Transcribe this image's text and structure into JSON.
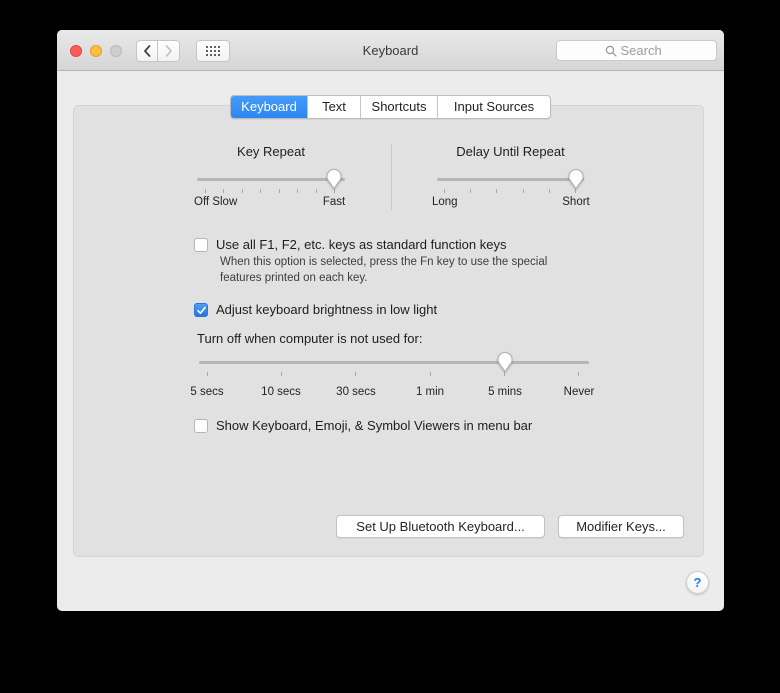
{
  "window": {
    "title": "Keyboard",
    "toolbar": {
      "search_placeholder": "Search"
    },
    "tabs": [
      {
        "label": "Keyboard",
        "selected": true
      },
      {
        "label": "Text",
        "selected": false
      },
      {
        "label": "Shortcuts",
        "selected": false
      },
      {
        "label": "Input Sources",
        "selected": false
      }
    ],
    "help_label": "?"
  },
  "panel": {
    "key_repeat": {
      "title": "Key Repeat",
      "min_label": "Off Slow",
      "max_label": "Fast",
      "ticks": 8,
      "value_index": 7,
      "value": "Fast"
    },
    "delay": {
      "title": "Delay Until Repeat",
      "min_label": "Long",
      "max_label": "Short",
      "ticks": 6,
      "value_index": 5,
      "value": "Short"
    },
    "fn_checkbox": {
      "label": "Use all F1, F2, etc. keys as standard function keys",
      "checked": false,
      "description": [
        "When this option is selected, press the Fn key to use the special",
        "features printed on each key."
      ]
    },
    "brightness_checkbox": {
      "label": "Adjust keyboard brightness in low light",
      "checked": true
    },
    "turnoff": {
      "label": "Turn off when computer is not used for:",
      "options": [
        "5 secs",
        "10 secs",
        "30 secs",
        "1 min",
        "5 mins",
        "Never"
      ],
      "value": "5 mins",
      "value_index": 4
    },
    "viewers_checkbox": {
      "label": "Show Keyboard, Emoji, & Symbol Viewers in menu bar",
      "checked": false
    },
    "buttons": {
      "bluetooth": "Set Up Bluetooth Keyboard...",
      "modifier": "Modifier Keys..."
    }
  },
  "colors": {
    "tab_selected": "#3693f5",
    "checkbox_checked": "#2f7cf6",
    "help_accent": "#2879f5",
    "window_bg": "#ececec",
    "panel_bg": "#e1e1e1"
  }
}
